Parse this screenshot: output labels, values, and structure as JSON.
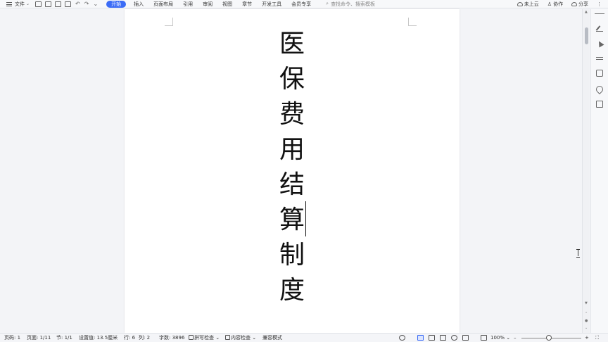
{
  "toolbar": {
    "file_label": "文件",
    "tabs": [
      "开始",
      "插入",
      "页面布局",
      "引用",
      "审阅",
      "视图",
      "章节",
      "开发工具",
      "会员专享"
    ],
    "search_placeholder": "查找命令、搜索模板",
    "cloud_label": "未上云",
    "collab_label": "协作",
    "share_label": "分享"
  },
  "document": {
    "chars": [
      "医",
      "保",
      "费",
      "用",
      "结",
      "算",
      "制",
      "度"
    ]
  },
  "status": {
    "page_num": "页码: 1",
    "pages": "页面: 1/11",
    "section": "节: 1/1",
    "setting": "设置值: 13.5厘米",
    "row": "行: 6",
    "col": "列: 2",
    "word_count": "字数: 3896",
    "spell_check": "拼写检查",
    "content_check": "内容检查",
    "compat_mode": "兼容模式",
    "zoom": "100%",
    "zoom_minus": "–",
    "zoom_plus": "+",
    "zoom_level": 0.46
  },
  "colors": {
    "accent": "#3b6cf6"
  }
}
